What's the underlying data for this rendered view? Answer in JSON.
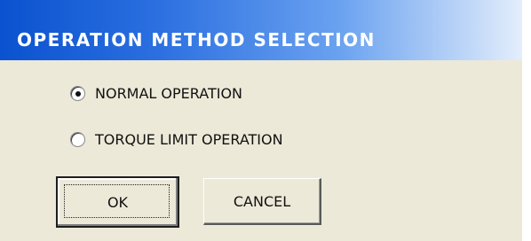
{
  "dialog": {
    "title": "OPERATION METHOD SELECTION"
  },
  "options": [
    {
      "label": "NORMAL OPERATION",
      "selected": true
    },
    {
      "label": "TORQUE LIMIT OPERATION",
      "selected": false
    }
  ],
  "buttons": {
    "ok_label": "OK",
    "cancel_label": "CANCEL"
  },
  "colors": {
    "title_bar_start": "#0a52cf",
    "title_bar_end": "#e4eefc",
    "dialog_background": "#ece9d8",
    "title_text": "#ffffff"
  }
}
